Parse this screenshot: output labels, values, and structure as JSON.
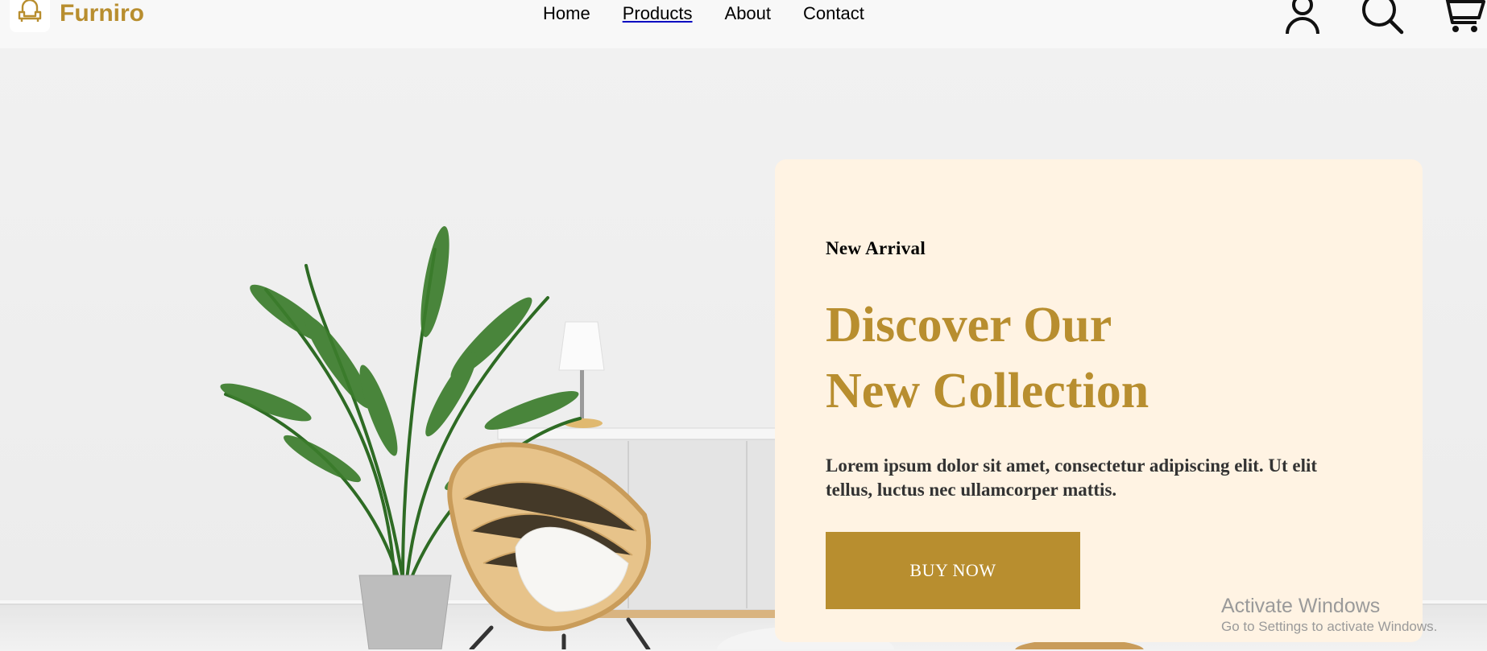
{
  "header": {
    "brand": "Furniro",
    "nav": [
      {
        "label": "Home",
        "active": false
      },
      {
        "label": "Products",
        "active": true
      },
      {
        "label": "About",
        "active": false
      },
      {
        "label": "Contact",
        "active": false
      }
    ],
    "icons": [
      "user-icon",
      "search-icon",
      "cart-icon"
    ]
  },
  "hero": {
    "eyebrow": "New Arrival",
    "headline_line1": "Discover Our",
    "headline_line2": "New Collection",
    "body": "Lorem ipsum dolor sit amet, consectetur adipiscing elit. Ut elit tellus, luctus nec ullamcorper mattis.",
    "cta_label": "BUY NOW"
  },
  "watermark": {
    "title": "Activate Windows",
    "subtitle": "Go to Settings to activate Windows."
  },
  "colors": {
    "brand": "#b88e2f",
    "card_bg": "#fff3e3",
    "header_bg": "#f8f8f8"
  }
}
